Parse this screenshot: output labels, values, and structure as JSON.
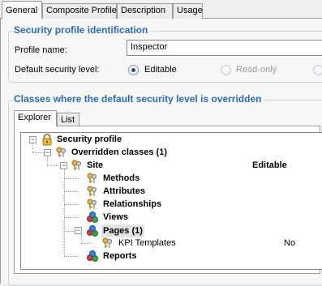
{
  "tabs": [
    "General",
    "Composite Profile",
    "Description",
    "Usage"
  ],
  "identification": {
    "title": "Security profile identification",
    "profile_name_label": "Profile name:",
    "profile_name_value": "Inspector",
    "level_label": "Default security level:",
    "options": [
      "Editable",
      "Read-only"
    ],
    "selected": "Editable"
  },
  "overrides": {
    "title": "Classes where the default security level is overridden",
    "tabs": [
      "Explorer",
      "List"
    ]
  },
  "tree": {
    "root": "Security profile",
    "overridden": "Overridden classes (1)",
    "site": "Site",
    "site_value": "Editable",
    "children": [
      "Methods",
      "Attributes",
      "Relationships",
      "Views",
      "Pages (1)",
      "Reports"
    ],
    "page_child": "KPI Templates",
    "page_child_value": "No"
  }
}
